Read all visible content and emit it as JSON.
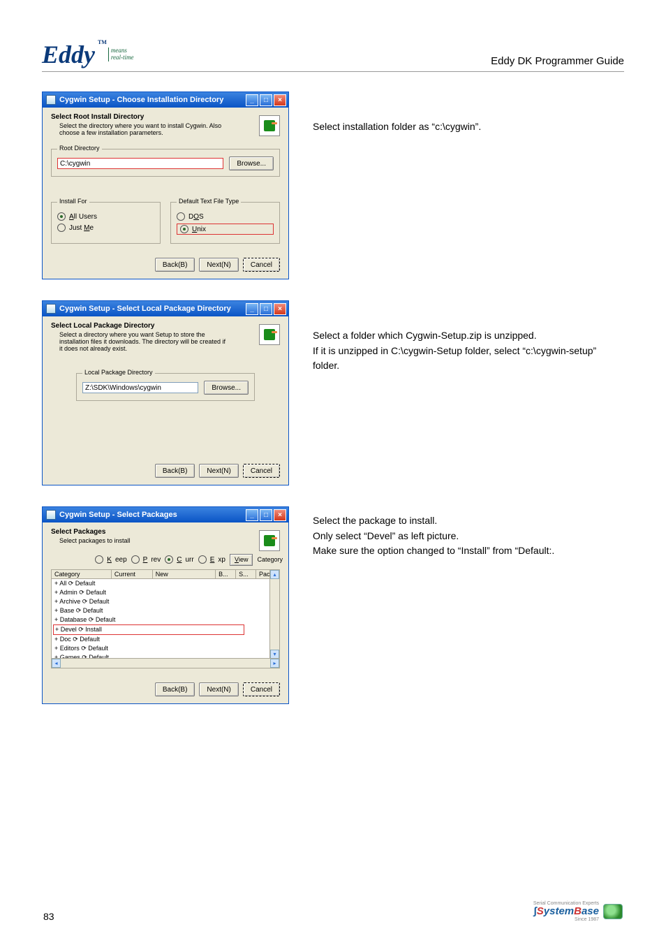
{
  "header": {
    "logo_main": "Eddy",
    "logo_tm": "TM",
    "logo_sub1": "means",
    "logo_sub2": "real-time",
    "guide": "Eddy DK Programmer Guide"
  },
  "win": {
    "min": "_",
    "max": "□",
    "close": "×"
  },
  "dlg1": {
    "title": "Cygwin Setup - Choose Installation Directory",
    "head": "Select Root Install Directory",
    "desc": "Select the directory where you want to install Cygwin.  Also choose a few installation parameters.",
    "root_grp": "Root Directory",
    "root_val": "C:\\cygwin",
    "browse": "Browse...",
    "install_for": "Install For",
    "all_users": "All Users",
    "just_me": "Just Me",
    "text_type": "Default Text File Type",
    "dos": "DOS",
    "unix": "Unix",
    "back": "Back(B)",
    "next": "Next(N)",
    "cancel": "Cancel"
  },
  "side1": "Select installation folder as  “c:\\cygwin”.",
  "dlg2": {
    "title": "Cygwin Setup - Select Local Package Directory",
    "head": "Select Local Package Directory",
    "desc": "Select a directory where you want Setup to store the installation files it downloads.  The directory will be created if it does not already exist.",
    "grp": "Local Package Directory",
    "val": "Z:\\SDK\\Windows\\cygwin",
    "browse": "Browse...",
    "back": "Back(B)",
    "next": "Next(N)",
    "cancel": "Cancel"
  },
  "side2_l1": "Select a folder which Cygwin-Setup.zip is unzipped.",
  "side2_l2": "If it is unzipped in C:\\cygwin-Setup folder, select  “c:\\cygwin-setup”  folder.",
  "dlg3": {
    "title": "Cygwin Setup - Select Packages",
    "head": "Select Packages",
    "desc": "Select packages to install",
    "keep": "Keep",
    "prev": "Prev",
    "curr": "Curr",
    "exp": "Exp",
    "view": "View",
    "category_lbl": "Category",
    "hdr_cat": "Category",
    "hdr_cur": "Current",
    "hdr_new": "New",
    "hdr_b": "B...",
    "hdr_s": "S...",
    "hdr_pkg": "Packa",
    "items": [
      "+ All ⟳ Default",
      "  + Admin ⟳ Default",
      "  + Archive ⟳ Default",
      "  + Base ⟳ Default",
      "  + Database ⟳ Default",
      "  + Devel ⟳ Install",
      "  + Doc ⟳ Default",
      "  + Editors ⟳ Default",
      "  + Games ⟳ Default"
    ],
    "back": "Back(B)",
    "next": "Next(N)",
    "cancel": "Cancel"
  },
  "side3_l1": "Select the package to install.",
  "side3_l2": "Only select  “Devel”  as left picture.",
  "side3_l3": "Make sure the option changed to  “Install” from  “Default:.",
  "pagenum": "83",
  "sbase": {
    "sce": "Serial Communication Experts",
    "main1": "S",
    "main2": "ystem",
    "main3": "B",
    "main4": "ase",
    "since": "Since 1987"
  }
}
